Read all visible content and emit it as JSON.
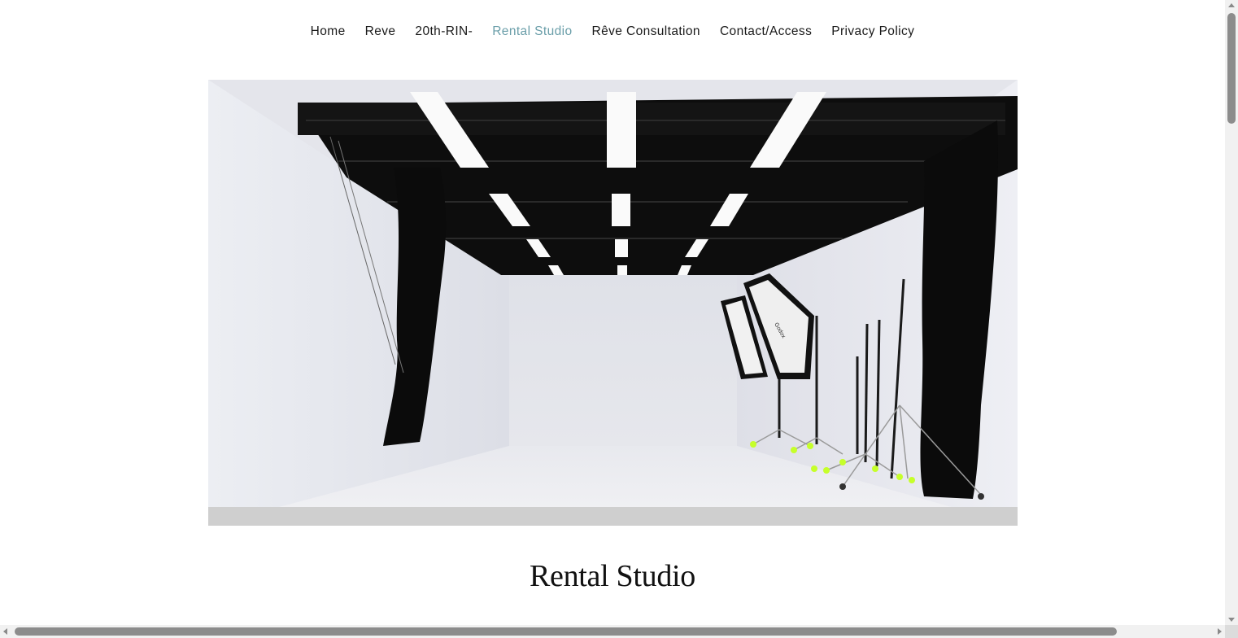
{
  "nav": {
    "items": [
      {
        "label": "Home",
        "active": false
      },
      {
        "label": "Reve",
        "active": false
      },
      {
        "label": "20th-RIN-",
        "active": false
      },
      {
        "label": "Rental Studio",
        "active": true
      },
      {
        "label": "Rêve Consultation",
        "active": false
      },
      {
        "label": "Contact/Access",
        "active": false
      },
      {
        "label": "Privacy Policy",
        "active": false
      }
    ],
    "active_color": "#6a9ea9"
  },
  "hero": {
    "image_name": "rental-studio-photo",
    "softbox_brand": "Godox"
  },
  "main": {
    "title": "Rental Studio"
  }
}
